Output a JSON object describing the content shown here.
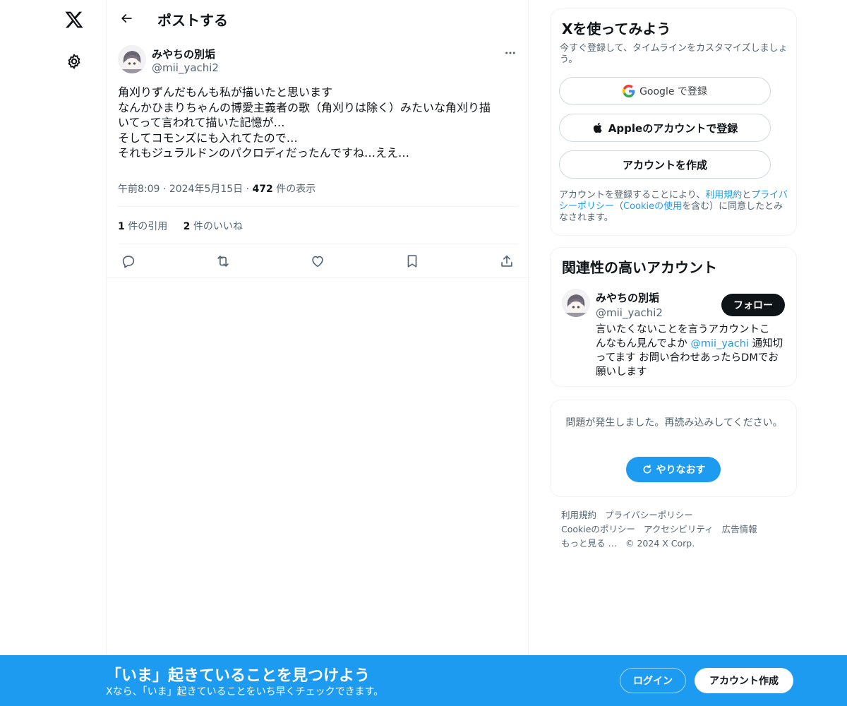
{
  "nav": {
    "logo_icon": "x-logo-icon",
    "settings_icon": "gear-icon"
  },
  "header": {
    "title": "ポストする",
    "back_icon": "arrow-left-icon"
  },
  "post": {
    "author_name": "みやちの別垢",
    "author_handle": "@mii_yachi2",
    "lines": [
      "角刈りずんだもんも私が描いたと思います",
      "なんかひまりちゃんの博愛主義者の歌（角刈りは除く）みたいな角刈り描",
      "いてって言われて描いた記憶が…",
      "そしてコモンズにも入れてたので…",
      "それもジュラルドンのパクロディだったんですね…ええ…"
    ],
    "time": "午前8:09",
    "date": "2024年5月15日",
    "views_count": "472",
    "views_label": "件の表示",
    "quotes_count": "1",
    "quotes_label": "件の引用",
    "likes_count": "2",
    "likes_label": "件のいいね"
  },
  "signup_card": {
    "title": "Xを使ってみよう",
    "subtitle": "今すぐ登録して、タイムラインをカスタマイズしましょう。",
    "google_label": "Google で登録",
    "apple_label": "Appleのアカウントで登録",
    "create_label": "アカウントを作成",
    "terms_prefix": "アカウントを登録することにより、",
    "terms_link": "利用規約",
    "terms_and": "と",
    "privacy_link": "プライバシーポリシー",
    "cookie_open": "（",
    "cookie_link": "Cookieの使用",
    "terms_suffix": "を含む）に同意したとみなされます。"
  },
  "related_card": {
    "title": "関連性の高いアカウント",
    "name": "みやちの別垢",
    "handle": "@mii_yachi2",
    "follow_label": "フォロー",
    "bio_line1": "言いたくないことを言うアカウントこ",
    "bio_line2_pre": "んなもん見んでよか ",
    "bio_mention": "@mii_yachi",
    "bio_line2_post": " 通知切",
    "bio_line3": "ってます お問い合わせあったらDMでお",
    "bio_line4": "願いします"
  },
  "error_card": {
    "message": "問題が発生しました。再読み込みしてください。",
    "retry_label": "やりなおす"
  },
  "footer": {
    "links": [
      "利用規約",
      "プライバシーポリシー",
      "Cookieのポリシー",
      "アクセシビリティ",
      "広告情報",
      "もっと見る …",
      "© 2024 X Corp."
    ]
  },
  "banner": {
    "title": "「いま」起きていることを見つけよう",
    "subtitle": "Xなら、「いま」起きていることをいち早くチェックできます。",
    "login_label": "ログイン",
    "signup_label": "アカウント作成"
  },
  "colors": {
    "accent": "#1d9bf0",
    "text": "#0f1419",
    "muted": "#536471",
    "border": "#eff3f4"
  }
}
